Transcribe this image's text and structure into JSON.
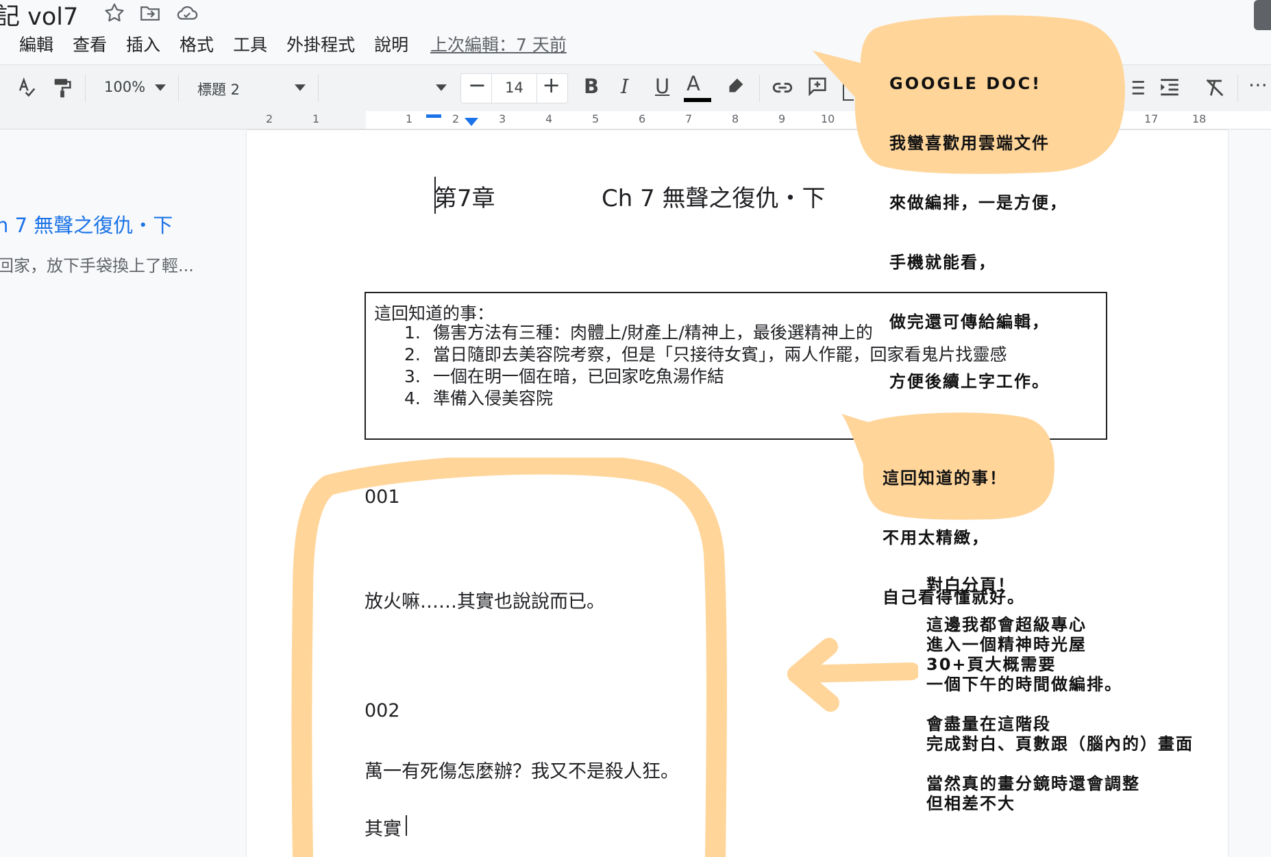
{
  "document": {
    "title": "記 vol7"
  },
  "title_icons": [
    "star-icon",
    "move-to-folder-icon",
    "cloud-saved-icon"
  ],
  "menu": {
    "items": [
      "編輯",
      "查看",
      "插入",
      "格式",
      "工具",
      "外掛程式",
      "說明"
    ],
    "last_edit": "上次編輯：7 天前"
  },
  "toolbar": {
    "zoom": "100%",
    "style": "標題 2",
    "font_size": "14",
    "bold": "B",
    "italic": "I",
    "underline": "U",
    "text_color": "A"
  },
  "ruler": {
    "left_numbers": [
      "2",
      "1"
    ],
    "right_numbers": [
      "1",
      "2",
      "3",
      "4",
      "5",
      "6",
      "7",
      "8",
      "9",
      "10"
    ],
    "far_numbers": [
      "17",
      "18"
    ]
  },
  "outline": {
    "heading": "h 7 無聲之復仇・下",
    "snippet": "回家，放下手袋換上了輕..."
  },
  "page": {
    "chapter_number": "第7章",
    "chapter_title": "Ch 7 無聲之復仇・下",
    "notes_heading": "這回知道的事：",
    "notes": [
      {
        "num": "1.",
        "text": "傷害方法有三種：肉體上/財產上/精神上，最後選精神上的"
      },
      {
        "num": "2.",
        "text": "當日隨即去美容院考察，但是「只接待女賓」，兩人作罷，回家看鬼片找靈感"
      },
      {
        "num": "3.",
        "text": "一個在明一個在暗，已回家吃魚湯作結"
      },
      {
        "num": "4.",
        "text": "準備入侵美容院"
      }
    ],
    "page1_label": "001",
    "page1_line": "放火嘛……其實也說說而已。",
    "page2_label": "002",
    "page2_line": "萬一有死傷怎麼辦？我又不是殺人狂。",
    "page2_next": "其實"
  },
  "annotations": {
    "bubble1": [
      "GOOGLE DOC!",
      "我蠻喜歡用雲端文件",
      "來做編排，一是方便，",
      "手機就能看，",
      "做完還可傳給編輯，",
      "方便後續上字工作。"
    ],
    "bubble2": [
      "這回知道的事！",
      "不用太精緻，",
      "自己看得懂就好。"
    ],
    "note3": "對白分頁！\n\n這邊我都會超級專心\n進入一個精神時光屋\n30+頁大概需要\n一個下午的時間做編排。\n\n會盡量在這階段\n完成對白、頁數跟（腦內的）畫面\n\n當然真的畫分鏡時還會調整\n但相差不大"
  },
  "colors": {
    "highlight": "#ffd59a",
    "link_blue": "#1a73e8",
    "ruler_marker": "#1a73e8"
  }
}
